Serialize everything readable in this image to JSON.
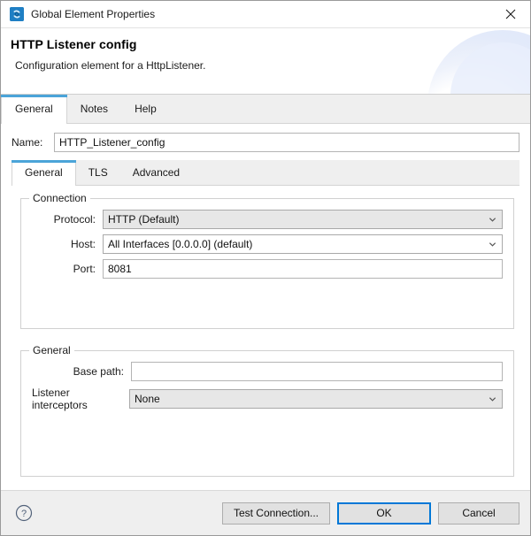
{
  "window": {
    "title": "Global Element Properties",
    "icon": "mule-app-icon",
    "close_label": "close-icon"
  },
  "header": {
    "title": "HTTP Listener config",
    "subtitle": "Configuration element for a HttpListener."
  },
  "outer_tabs": [
    {
      "label": "General",
      "selected": true
    },
    {
      "label": "Notes",
      "selected": false
    },
    {
      "label": "Help",
      "selected": false
    }
  ],
  "name_field": {
    "label": "Name:",
    "value": "HTTP_Listener_config",
    "placeholder": ""
  },
  "inner_tabs": [
    {
      "label": "General",
      "selected": true
    },
    {
      "label": "TLS",
      "selected": false
    },
    {
      "label": "Advanced",
      "selected": false
    }
  ],
  "connection_group": {
    "title": "Connection",
    "fields": [
      {
        "label": "Protocol:",
        "value": "HTTP (Default)",
        "type": "combo",
        "disabled": true
      },
      {
        "label": "Host:",
        "value": "All Interfaces [0.0.0.0] (default)",
        "type": "combo",
        "disabled": false
      },
      {
        "label": "Port:",
        "value": "8081",
        "type": "text",
        "placeholder": ""
      }
    ]
  },
  "general_group": {
    "title": "General",
    "base_path": {
      "label": "Base path:",
      "value": "",
      "placeholder": ""
    },
    "listener_interceptors": {
      "label": "Listener interceptors",
      "value": "None"
    }
  },
  "footer": {
    "help_icon": "help-circle-icon",
    "buttons": [
      {
        "label": "Test Connection...",
        "default": false
      },
      {
        "label": "OK",
        "default": true
      },
      {
        "label": "Cancel",
        "default": false
      }
    ]
  },
  "colors": {
    "accent_blue": "#4ba4d8",
    "default_button_border": "#0078d7",
    "app_icon": "#1f7fc4",
    "panel_grey": "#efefef",
    "disabled_field": "#e7e7e7"
  }
}
